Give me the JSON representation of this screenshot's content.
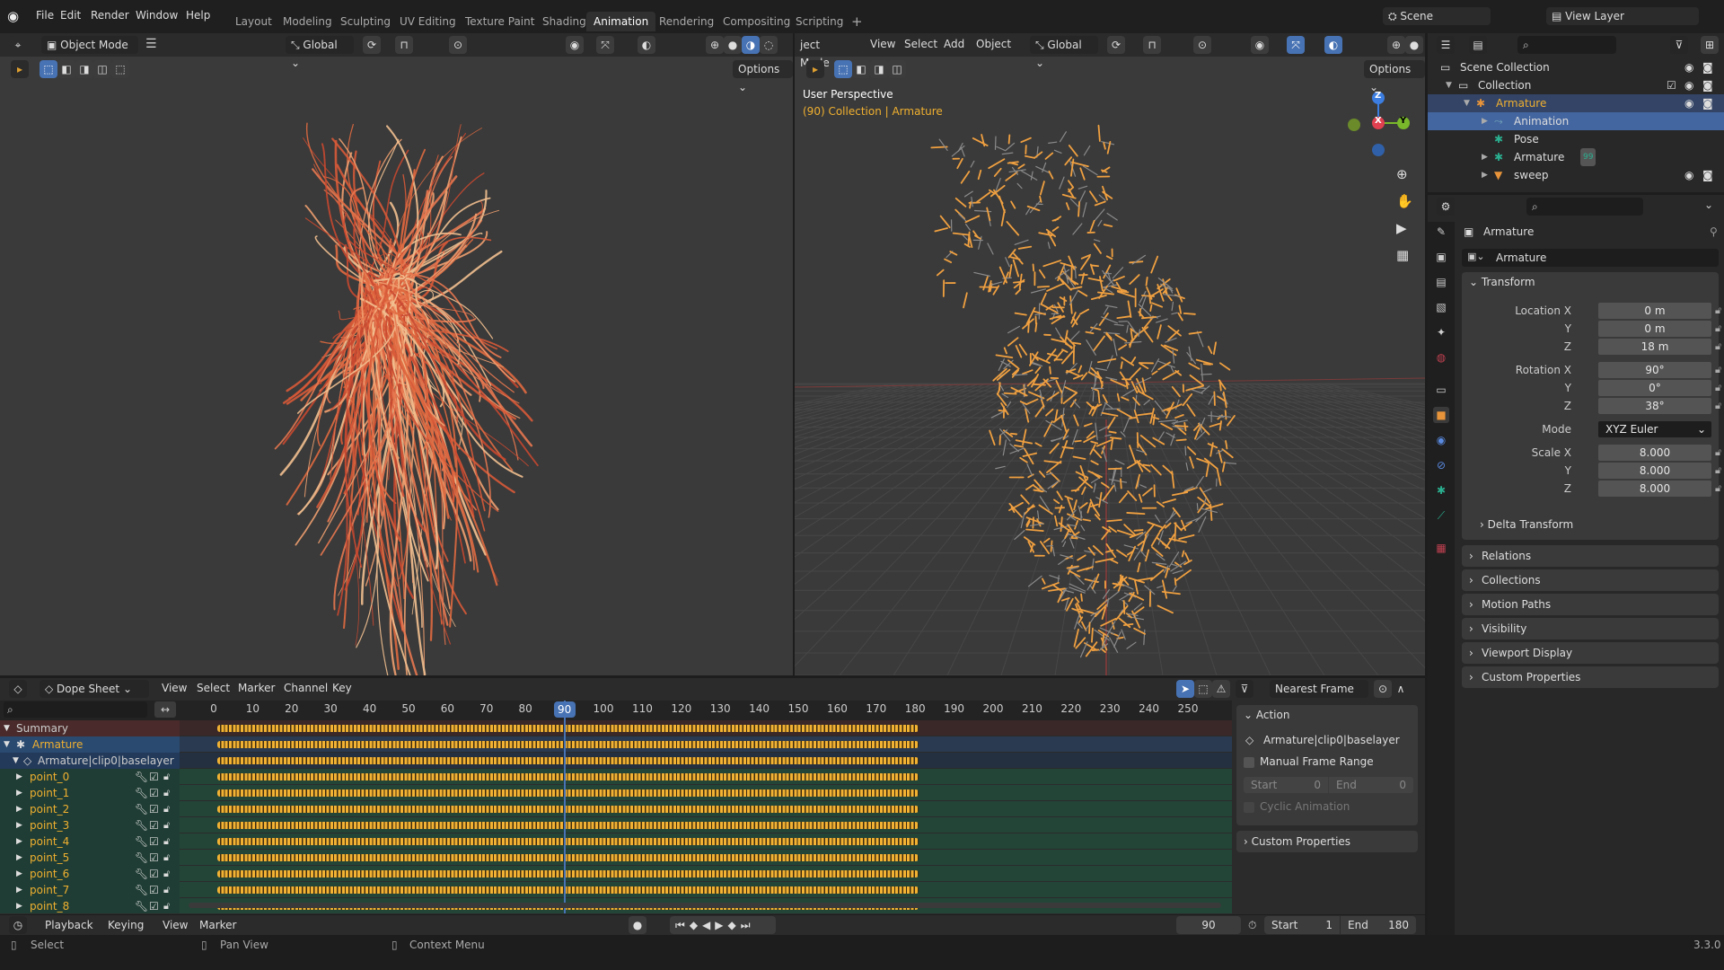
{
  "topbar": {
    "menus": [
      "File",
      "Edit",
      "Render",
      "Window",
      "Help"
    ],
    "workspaces": [
      "Layout",
      "Modeling",
      "Sculpting",
      "UV Editing",
      "Texture Paint",
      "Shading",
      "Animation",
      "Rendering",
      "Compositing",
      "Scripting"
    ],
    "active_workspace": "Animation",
    "add_tab": "+",
    "scene": "Scene",
    "view_layer": "View Layer"
  },
  "left_viewport": {
    "mode": "Object Mode",
    "orientation": "Global",
    "options": "Options"
  },
  "right_viewport": {
    "mode": "ject Mode",
    "menus": [
      "View",
      "Select",
      "Add",
      "Object"
    ],
    "orientation": "Global",
    "options": "Options",
    "overlay_title": "User Perspective",
    "overlay_sub": "(90) Collection | Armature",
    "gizmo": {
      "x": "X",
      "y": "Y",
      "z": "Z"
    }
  },
  "outliner": {
    "rows": [
      {
        "label": "Scene Collection",
        "indent": 0
      },
      {
        "label": "Collection",
        "indent": 1
      },
      {
        "label": "Armature",
        "indent": 2
      },
      {
        "label": "Animation",
        "indent": 3
      },
      {
        "label": "Pose",
        "indent": 3
      },
      {
        "label": "Armature",
        "indent": 3,
        "badge": "99"
      },
      {
        "label": "sweep",
        "indent": 3
      }
    ]
  },
  "properties": {
    "object_name": "Armature",
    "data_name": "Armature",
    "transform_title": "Transform",
    "fields": [
      {
        "label": "Location X",
        "value": "0 m"
      },
      {
        "label": "Y",
        "value": "0 m"
      },
      {
        "label": "Z",
        "value": "18 m"
      },
      {
        "label": "Rotation X",
        "value": "90°"
      },
      {
        "label": "Y",
        "value": "0°"
      },
      {
        "label": "Z",
        "value": "38°"
      },
      {
        "label": "Mode",
        "value": "XYZ Euler"
      },
      {
        "label": "Scale X",
        "value": "8.000"
      },
      {
        "label": "Y",
        "value": "8.000"
      },
      {
        "label": "Z",
        "value": "8.000"
      }
    ],
    "delta": "Delta Transform",
    "sections": [
      "Relations",
      "Collections",
      "Motion Paths",
      "Visibility",
      "Viewport Display",
      "Custom Properties"
    ]
  },
  "dopesheet": {
    "mode": "Dope Sheet",
    "menus": [
      "View",
      "Select",
      "Marker",
      "Channel",
      "Key"
    ],
    "snap": "Nearest Frame",
    "ticks": [
      0,
      10,
      20,
      30,
      40,
      50,
      60,
      70,
      80,
      90,
      100,
      110,
      120,
      130,
      140,
      150,
      160,
      170,
      180,
      190,
      200,
      210,
      220,
      230,
      240,
      250
    ],
    "current_frame": 90,
    "key_start": 0,
    "key_end": 180,
    "channels": [
      {
        "label": "Summary",
        "type": "summary"
      },
      {
        "label": "Armature",
        "type": "object"
      },
      {
        "label": "Armature|clip0|baselayer",
        "type": "action"
      },
      {
        "label": "point_0",
        "type": "group"
      },
      {
        "label": "point_1",
        "type": "group"
      },
      {
        "label": "point_2",
        "type": "group"
      },
      {
        "label": "point_3",
        "type": "group"
      },
      {
        "label": "point_4",
        "type": "group"
      },
      {
        "label": "point_5",
        "type": "group"
      },
      {
        "label": "point_6",
        "type": "group"
      },
      {
        "label": "point_7",
        "type": "group"
      },
      {
        "label": "point_8",
        "type": "group"
      }
    ],
    "sidebar": {
      "action_title": "Action",
      "action_name": "Armature|clip0|baselayer",
      "manual_range": "Manual Frame Range",
      "start_label": "Start",
      "start_value": "0",
      "end_label": "End",
      "end_value": "0",
      "cyclic": "Cyclic Animation",
      "custom_props": "Custom Properties"
    }
  },
  "timeline": {
    "menus": [
      "Playback",
      "Keying",
      "View",
      "Marker"
    ],
    "current": "90",
    "start_label": "Start",
    "start": "1",
    "end_label": "End",
    "end": "180"
  },
  "statusbar": {
    "select": "Select",
    "pan": "Pan View",
    "context": "Context Menu",
    "version": "3.3.0"
  },
  "colors": {
    "accent": "#4772b3",
    "active_text": "#f0b030",
    "heart_left": "#e0603a",
    "heart_right": "#e8942e"
  }
}
